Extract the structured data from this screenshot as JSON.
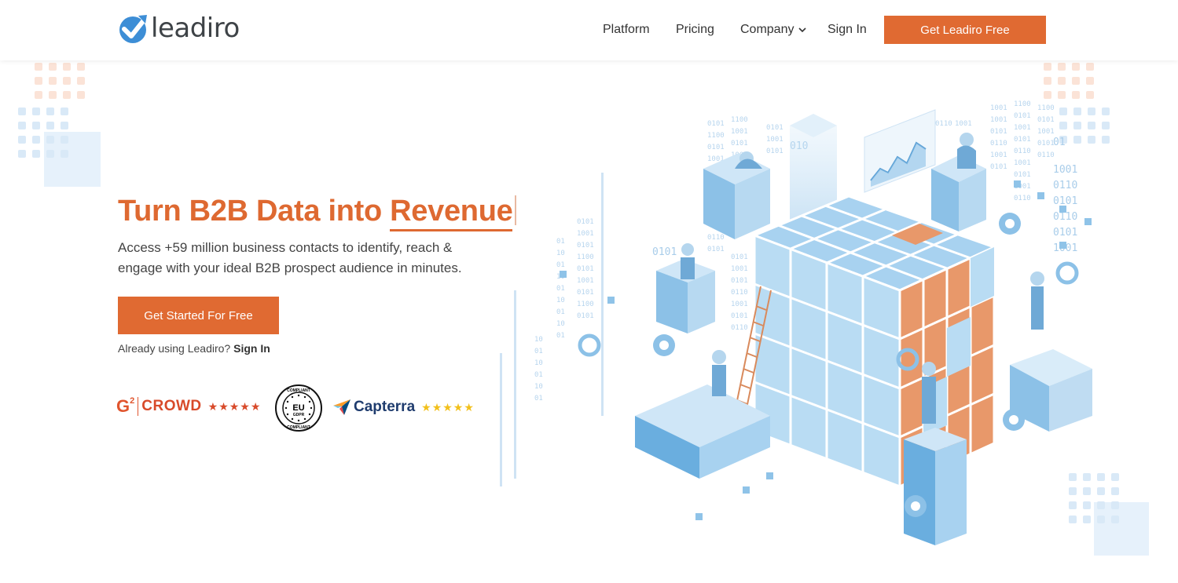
{
  "header": {
    "logo_text": "leadiro",
    "nav": {
      "platform": "Platform",
      "pricing": "Pricing",
      "company": "Company",
      "sign_in": "Sign In"
    },
    "cta": "Get Leadiro Free"
  },
  "hero": {
    "headline_prefix": "Turn B2B Data into ",
    "headline_highlight": "Revenue",
    "subtext": "Access +59 million business contacts to identify, reach & engage with your ideal B2B prospect audience in minutes.",
    "cta": "Get Started For Free",
    "already_text": "Already using Leadiro?",
    "already_link": "Sign In"
  },
  "badges": {
    "g2_logo": "G",
    "g2_sup": "2",
    "g2_text": "CROWD",
    "g2_stars": "★★★★★",
    "gdpr_top": "COMPLIANT",
    "gdpr_mid": "EU",
    "gdpr_sub": "GDPR",
    "gdpr_bottom": "COMPLIANT",
    "capterra_text": "Capterra",
    "capterra_stars": "★★★★★"
  },
  "colors": {
    "accent": "#e06a32",
    "headline": "#de6931",
    "illustration_blue": "#8fc3e8",
    "illustration_orange": "#e8986a"
  },
  "icons": [
    "logo-check-icon",
    "chevron-down-icon",
    "g2-crowd-logo",
    "gdpr-seal-icon",
    "capterra-logo-icon",
    "data-cube-illustration"
  ]
}
